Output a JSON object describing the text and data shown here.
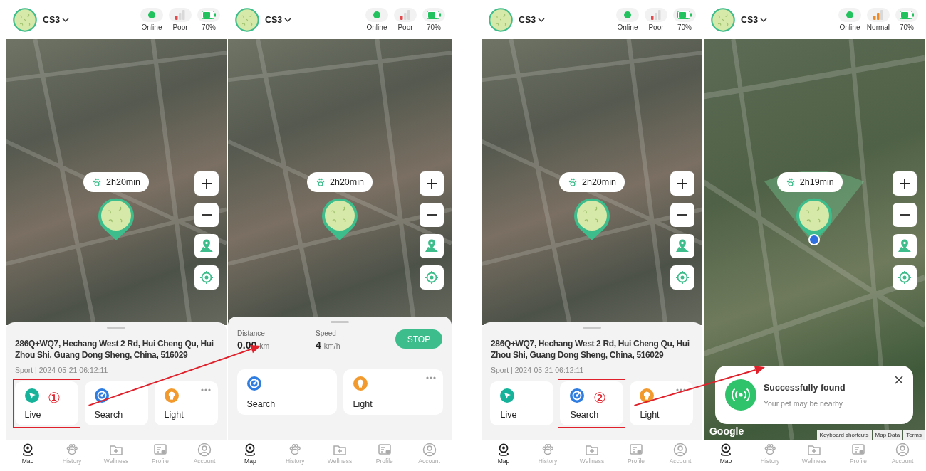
{
  "phones": [
    {
      "device": {
        "name": "CS3"
      },
      "status": [
        {
          "kind": "online",
          "label": "Online"
        },
        {
          "kind": "signal",
          "color": "#e5474b",
          "label": "Poor"
        },
        {
          "kind": "battery",
          "level": 0.7,
          "label": "70%"
        }
      ],
      "map": {
        "time_badge": "2h20min",
        "found_marker": false
      },
      "sheet": {
        "kind": "address",
        "address": "286Q+WQ7, Hechang West 2 Rd, Hui Cheng Qu, Hui Zhou Shi, Guang Dong Sheng, China, 516029",
        "meta": "Sport | 2024-05-21 06:12:11",
        "actions": [
          {
            "kind": "live",
            "label": "Live",
            "callout": "①",
            "more": false
          },
          {
            "kind": "search",
            "label": "Search",
            "more": false
          },
          {
            "kind": "light",
            "label": "Light",
            "more": true
          }
        ]
      },
      "nav": [
        {
          "kind": "map",
          "label": "Map",
          "selected": true
        },
        {
          "kind": "history",
          "label": "History",
          "selected": false
        },
        {
          "kind": "wellness",
          "label": "Wellness",
          "selected": false
        },
        {
          "kind": "profile",
          "label": "Profile",
          "selected": false
        },
        {
          "kind": "account",
          "label": "Account",
          "selected": false
        }
      ]
    },
    {
      "device": {
        "name": "CS3"
      },
      "status": [
        {
          "kind": "online",
          "label": "Online"
        },
        {
          "kind": "signal",
          "color": "#e5474b",
          "label": "Poor"
        },
        {
          "kind": "battery",
          "level": 0.7,
          "label": "70%"
        }
      ],
      "map": {
        "time_badge": "2h20min",
        "found_marker": false
      },
      "sheet": {
        "kind": "tracking",
        "distance_label": "Distance",
        "distance_value": "0.00",
        "distance_unit": "km",
        "speed_label": "Speed",
        "speed_value": "4",
        "speed_unit": "km/h",
        "stop_button": "STOP",
        "actions": [
          {
            "kind": "search",
            "label": "Search",
            "more": false
          },
          {
            "kind": "light",
            "label": "Light",
            "more": true
          }
        ]
      },
      "nav": [
        {
          "kind": "map",
          "label": "Map",
          "selected": true
        },
        {
          "kind": "history",
          "label": "History",
          "selected": false
        },
        {
          "kind": "wellness",
          "label": "Wellness",
          "selected": false
        },
        {
          "kind": "profile",
          "label": "Profile",
          "selected": false
        },
        {
          "kind": "account",
          "label": "Account",
          "selected": false
        }
      ]
    },
    {
      "device": {
        "name": "CS3"
      },
      "status": [
        {
          "kind": "online",
          "label": "Online"
        },
        {
          "kind": "signal",
          "color": "#e5474b",
          "label": "Poor"
        },
        {
          "kind": "battery",
          "level": 0.7,
          "label": "70%"
        }
      ],
      "map": {
        "time_badge": "2h20min",
        "found_marker": false
      },
      "sheet": {
        "kind": "address",
        "address": "286Q+WQ7, Hechang West 2 Rd, Hui Cheng Qu, Hui Zhou Shi, Guang Dong Sheng, China, 516029",
        "meta": "Sport | 2024-05-21 06:12:11",
        "actions": [
          {
            "kind": "live",
            "label": "Live",
            "more": false
          },
          {
            "kind": "search",
            "label": "Search",
            "callout": "②",
            "more": false
          },
          {
            "kind": "light",
            "label": "Light",
            "more": true
          }
        ]
      },
      "nav": [
        {
          "kind": "map",
          "label": "Map",
          "selected": true
        },
        {
          "kind": "history",
          "label": "History",
          "selected": false
        },
        {
          "kind": "wellness",
          "label": "Wellness",
          "selected": false
        },
        {
          "kind": "profile",
          "label": "Profile",
          "selected": false
        },
        {
          "kind": "account",
          "label": "Account",
          "selected": false
        }
      ]
    },
    {
      "device": {
        "name": "CS3"
      },
      "status": [
        {
          "kind": "online",
          "label": "Online"
        },
        {
          "kind": "signal",
          "color": "#f08a24",
          "label": "Normal"
        },
        {
          "kind": "battery",
          "level": 0.7,
          "label": "70%"
        }
      ],
      "map": {
        "time_badge": "2h19min",
        "found_marker": true,
        "toast": {
          "title": "Successfully found",
          "message": "Your pet may be nearby"
        },
        "attribution": {
          "logo": "Google",
          "links": [
            "Keyboard shortcuts",
            "Map Data",
            "Terms"
          ]
        }
      },
      "nav": [
        {
          "kind": "map",
          "label": "Map",
          "selected": true
        },
        {
          "kind": "history",
          "label": "History",
          "selected": false
        },
        {
          "kind": "wellness",
          "label": "Wellness",
          "selected": false
        },
        {
          "kind": "profile",
          "label": "Profile",
          "selected": false
        },
        {
          "kind": "account",
          "label": "Account",
          "selected": false
        }
      ]
    }
  ]
}
